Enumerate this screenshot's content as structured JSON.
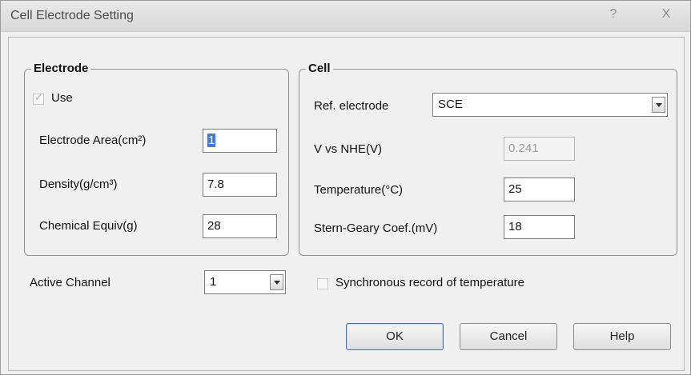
{
  "window": {
    "title": "Cell Electrode Setting",
    "help_glyph": "?",
    "close_glyph": "X"
  },
  "electrode": {
    "legend": "Electrode",
    "use_label": "Use",
    "use_checked": true,
    "area_label": "Electrode Area(cm²)",
    "area_value": "1",
    "density_label": "Density(g/cm³)",
    "density_value": "7.8",
    "equiv_label": "Chemical Equiv(g)",
    "equiv_value": "28"
  },
  "cell": {
    "legend": "Cell",
    "ref_label": "Ref. electrode",
    "ref_value": "SCE",
    "vnhe_label": "V vs NHE(V)",
    "vnhe_value": "0.241",
    "temp_label": "Temperature(°C)",
    "temp_value": "25",
    "stern_label": "Stern-Geary Coef.(mV)",
    "stern_value": "18"
  },
  "channel": {
    "label": "Active Channel",
    "value": "1"
  },
  "sync": {
    "label": "Synchronous record of temperature",
    "checked": false
  },
  "buttons": {
    "ok": "OK",
    "cancel": "Cancel",
    "help": "Help"
  },
  "icons": {
    "dropdown": "chevron-down-icon",
    "check": "checkmark-icon"
  }
}
